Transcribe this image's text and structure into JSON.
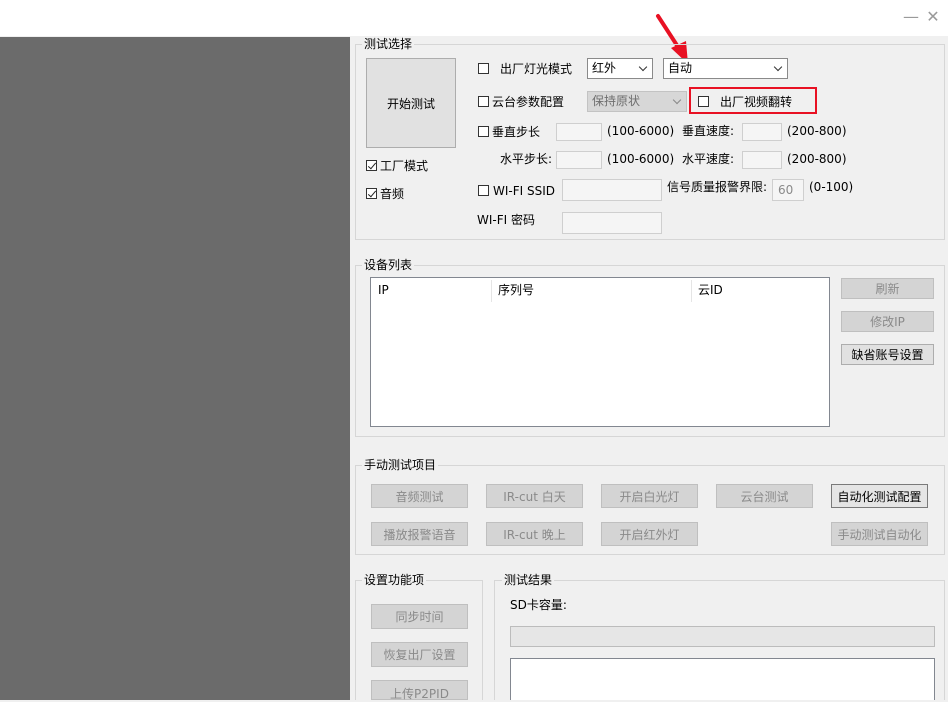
{
  "window": {
    "minimize": "—",
    "close": "✕"
  },
  "test_select": {
    "title": "测试选择",
    "start_button": "开始测试",
    "factory_mode": {
      "label": "工厂模式",
      "checked": true
    },
    "audio": {
      "label": "音频",
      "checked": true
    },
    "factory_light_mode": {
      "label": "出厂灯光模式",
      "value": "红外",
      "mode_value": "自动"
    },
    "ptz_config": {
      "label": "云台参数配置",
      "value": "保持原状"
    },
    "video_flip": {
      "label": "出厂视频翻转"
    },
    "vertical_step": {
      "label": "垂直步长",
      "range": "(100-6000)"
    },
    "vertical_speed": {
      "label": "垂直速度:",
      "range": "(200-800)"
    },
    "horizontal_step": {
      "label": "水平步长:",
      "range": "(100-6000)"
    },
    "horizontal_speed": {
      "label": "水平速度:",
      "range": "(200-800)"
    },
    "wifi_ssid": {
      "label": "WI-FI SSID"
    },
    "signal_threshold": {
      "label": "信号质量报警界限:",
      "value": "60",
      "range": "(0-100)"
    },
    "wifi_password": {
      "label": "WI-FI 密码"
    }
  },
  "device_list": {
    "title": "设备列表",
    "columns": [
      "IP",
      "序列号",
      "云ID"
    ],
    "refresh": "刷新",
    "modify_ip": "修改IP",
    "default_account": "缺省账号设置"
  },
  "manual_test": {
    "title": "手动测试项目",
    "row1": [
      "音频测试",
      "IR-cut 白天",
      "开启白光灯",
      "云台测试"
    ],
    "auto_config": "自动化测试配置",
    "row2": [
      "播放报警语音",
      "IR-cut 晚上",
      "开启红外灯"
    ],
    "manual_auto": "手动测试自动化"
  },
  "settings": {
    "title": "设置功能项",
    "sync_time": "同步时间",
    "restore_factory": "恢复出厂设置",
    "upload_p2pid": "上传P2PID"
  },
  "result": {
    "title": "测试结果",
    "sd_label": "SD卡容量:"
  },
  "colors": {
    "left_pane": "#6b6b6b",
    "highlight": "#e81123"
  }
}
